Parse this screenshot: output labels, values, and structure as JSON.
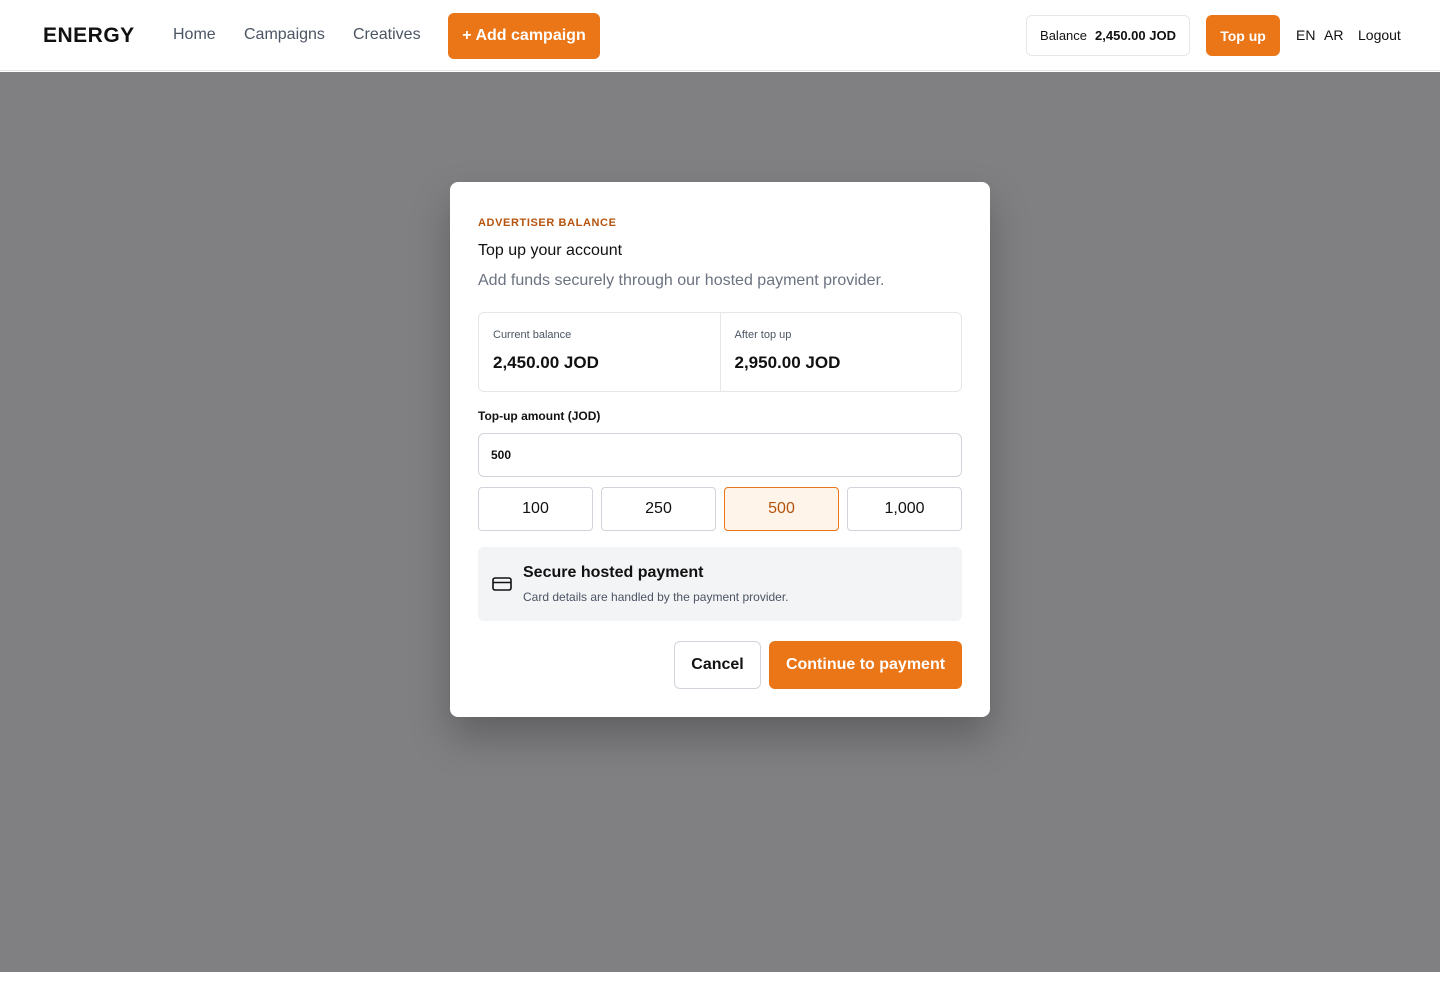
{
  "header": {
    "logo": "ENERGY",
    "nav": {
      "home": "Home",
      "campaigns": "Campaigns",
      "creatives": "Creatives"
    },
    "add_campaign_label": "+ Add campaign",
    "balance_label": "Balance",
    "balance_value": "2,450.00 JOD",
    "topup_label": "Top up",
    "lang_en": "EN",
    "lang_ar": "AR",
    "logout_label": "Logout"
  },
  "modal": {
    "eyebrow": "ADVERTISER BALANCE",
    "title": "Top up your account",
    "subtitle": "Add funds securely through our hosted payment provider.",
    "current_balance_label": "Current balance",
    "current_balance_value": "2,450.00 JOD",
    "after_topup_label": "After top up",
    "after_topup_value": "2,950.00 JOD",
    "amount_label": "Top-up amount (JOD)",
    "amount_value": "500",
    "presets": [
      "100",
      "250",
      "500",
      "1,000"
    ],
    "selected_preset": "500",
    "secure_title": "Secure hosted payment",
    "secure_desc": "Card details are handled by the payment provider.",
    "secure_icon": "credit-card-icon",
    "cancel_label": "Cancel",
    "continue_label": "Continue to payment"
  },
  "colors": {
    "accent": "#ea7618",
    "accent_dark": "#b5530e",
    "overlay": "#808083"
  }
}
